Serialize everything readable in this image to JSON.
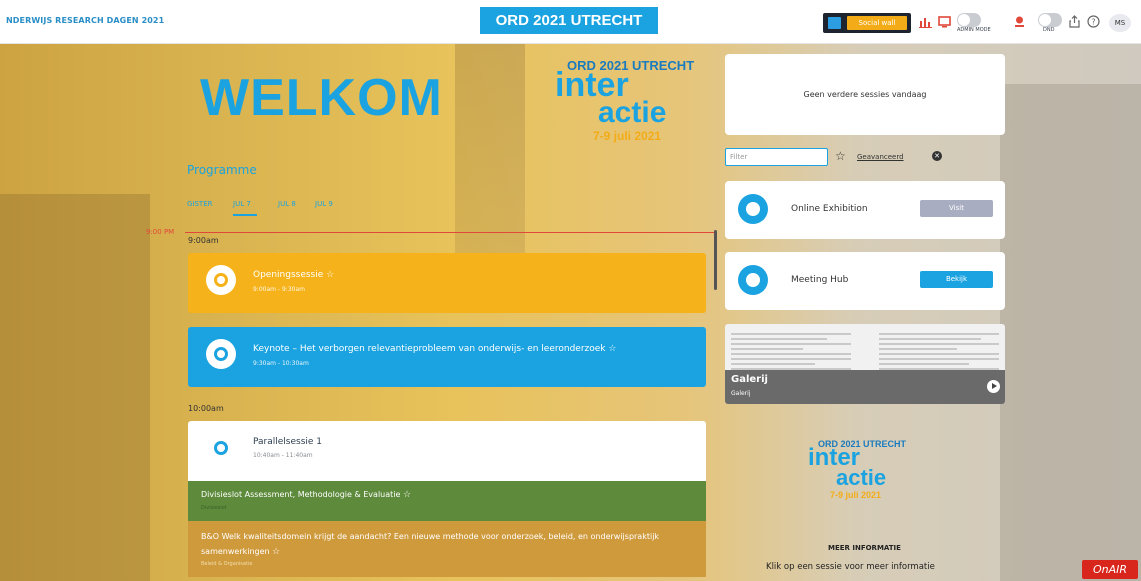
{
  "header": {
    "brand": "NDERWIJS RESEARCH DAGEN 2021",
    "event_badge": "ORD 2021 UTRECHT",
    "social_wall": "Social wall",
    "admin_mode": "ADMIN MODE",
    "dnd": "DND",
    "avatar": "MS"
  },
  "hero": {
    "welkom": "WELKOM",
    "logo": {
      "line1": "ORD 2021 UTRECHT",
      "line2": "inter",
      "line3": "actie",
      "dates": "7-9 juli 2021"
    }
  },
  "programme": {
    "title": "Programme",
    "tabs": [
      "GISTER",
      "JUL 7",
      "JUL 8",
      "JUL 9"
    ],
    "now_label": "9:00 PM",
    "times": [
      "9:00am",
      "10:00am"
    ],
    "sessions": [
      {
        "title": "Openingssessie",
        "time": "9:00am - 9:30am"
      },
      {
        "title": "Keynote – Het verborgen relevantieprobleem van onderwijs- en leeronderzoek",
        "time": "9:30am - 10:30am"
      },
      {
        "title": "Parallelsessie 1",
        "time": "10:40am - 11:40am"
      }
    ],
    "subsessions": [
      {
        "title": "Divisieslot Assessment, Methodologie & Evaluatie",
        "sub": "Divisieslot"
      },
      {
        "title": "B&O Welk kwaliteitsdomein krijgt de aandacht? Een nieuwe methode voor onderzoek, beleid, en onderwijspraktijk samenwerkingen",
        "sub": "Beleid & Organisatie"
      }
    ]
  },
  "sidebar": {
    "no_sessions": "Geen verdere sessies vandaag",
    "filter_placeholder": "Filter",
    "advanced": "Geavanceerd",
    "exhibition": {
      "label": "Online Exhibition",
      "button": "Visit"
    },
    "hub": {
      "label": "Meeting Hub",
      "button": "Bekijk"
    },
    "gallery": {
      "title": "Galerij",
      "subtitle": "Galerij"
    },
    "logo": {
      "line1": "ORD 2021 UTRECHT",
      "line2": "inter",
      "line3": "actie",
      "dates": "7-9 juli 2021"
    },
    "more_info": "MEER INFORMATIE",
    "click_hint": "Klik op een sessie voor meer informatie"
  },
  "onair": "OnAIR",
  "colors": {
    "accent": "#1aa3e0",
    "yellow": "#f5b21a",
    "green": "#5e8a3c",
    "orange": "#cf9a3c",
    "visit_btn": "#a9adc1"
  }
}
